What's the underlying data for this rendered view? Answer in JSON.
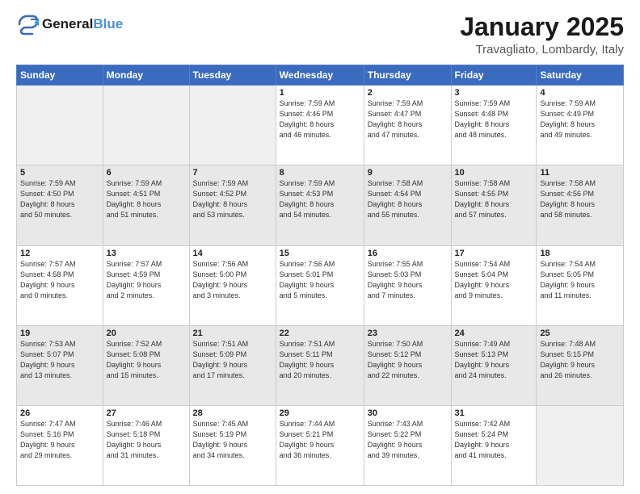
{
  "header": {
    "logo_line1": "General",
    "logo_line2": "Blue",
    "month": "January 2025",
    "location": "Travagliato, Lombardy, Italy"
  },
  "weekdays": [
    "Sunday",
    "Monday",
    "Tuesday",
    "Wednesday",
    "Thursday",
    "Friday",
    "Saturday"
  ],
  "weeks": [
    [
      {
        "day": "",
        "info": ""
      },
      {
        "day": "",
        "info": ""
      },
      {
        "day": "",
        "info": ""
      },
      {
        "day": "1",
        "info": "Sunrise: 7:59 AM\nSunset: 4:46 PM\nDaylight: 8 hours\nand 46 minutes."
      },
      {
        "day": "2",
        "info": "Sunrise: 7:59 AM\nSunset: 4:47 PM\nDaylight: 8 hours\nand 47 minutes."
      },
      {
        "day": "3",
        "info": "Sunrise: 7:59 AM\nSunset: 4:48 PM\nDaylight: 8 hours\nand 48 minutes."
      },
      {
        "day": "4",
        "info": "Sunrise: 7:59 AM\nSunset: 4:49 PM\nDaylight: 8 hours\nand 49 minutes."
      }
    ],
    [
      {
        "day": "5",
        "info": "Sunrise: 7:59 AM\nSunset: 4:50 PM\nDaylight: 8 hours\nand 50 minutes."
      },
      {
        "day": "6",
        "info": "Sunrise: 7:59 AM\nSunset: 4:51 PM\nDaylight: 8 hours\nand 51 minutes."
      },
      {
        "day": "7",
        "info": "Sunrise: 7:59 AM\nSunset: 4:52 PM\nDaylight: 8 hours\nand 53 minutes."
      },
      {
        "day": "8",
        "info": "Sunrise: 7:59 AM\nSunset: 4:53 PM\nDaylight: 8 hours\nand 54 minutes."
      },
      {
        "day": "9",
        "info": "Sunrise: 7:58 AM\nSunset: 4:54 PM\nDaylight: 8 hours\nand 55 minutes."
      },
      {
        "day": "10",
        "info": "Sunrise: 7:58 AM\nSunset: 4:55 PM\nDaylight: 8 hours\nand 57 minutes."
      },
      {
        "day": "11",
        "info": "Sunrise: 7:58 AM\nSunset: 4:56 PM\nDaylight: 8 hours\nand 58 minutes."
      }
    ],
    [
      {
        "day": "12",
        "info": "Sunrise: 7:57 AM\nSunset: 4:58 PM\nDaylight: 9 hours\nand 0 minutes."
      },
      {
        "day": "13",
        "info": "Sunrise: 7:57 AM\nSunset: 4:59 PM\nDaylight: 9 hours\nand 2 minutes."
      },
      {
        "day": "14",
        "info": "Sunrise: 7:56 AM\nSunset: 5:00 PM\nDaylight: 9 hours\nand 3 minutes."
      },
      {
        "day": "15",
        "info": "Sunrise: 7:56 AM\nSunset: 5:01 PM\nDaylight: 9 hours\nand 5 minutes."
      },
      {
        "day": "16",
        "info": "Sunrise: 7:55 AM\nSunset: 5:03 PM\nDaylight: 9 hours\nand 7 minutes."
      },
      {
        "day": "17",
        "info": "Sunrise: 7:54 AM\nSunset: 5:04 PM\nDaylight: 9 hours\nand 9 minutes."
      },
      {
        "day": "18",
        "info": "Sunrise: 7:54 AM\nSunset: 5:05 PM\nDaylight: 9 hours\nand 11 minutes."
      }
    ],
    [
      {
        "day": "19",
        "info": "Sunrise: 7:53 AM\nSunset: 5:07 PM\nDaylight: 9 hours\nand 13 minutes."
      },
      {
        "day": "20",
        "info": "Sunrise: 7:52 AM\nSunset: 5:08 PM\nDaylight: 9 hours\nand 15 minutes."
      },
      {
        "day": "21",
        "info": "Sunrise: 7:51 AM\nSunset: 5:09 PM\nDaylight: 9 hours\nand 17 minutes."
      },
      {
        "day": "22",
        "info": "Sunrise: 7:51 AM\nSunset: 5:11 PM\nDaylight: 9 hours\nand 20 minutes."
      },
      {
        "day": "23",
        "info": "Sunrise: 7:50 AM\nSunset: 5:12 PM\nDaylight: 9 hours\nand 22 minutes."
      },
      {
        "day": "24",
        "info": "Sunrise: 7:49 AM\nSunset: 5:13 PM\nDaylight: 9 hours\nand 24 minutes."
      },
      {
        "day": "25",
        "info": "Sunrise: 7:48 AM\nSunset: 5:15 PM\nDaylight: 9 hours\nand 26 minutes."
      }
    ],
    [
      {
        "day": "26",
        "info": "Sunrise: 7:47 AM\nSunset: 5:16 PM\nDaylight: 9 hours\nand 29 minutes."
      },
      {
        "day": "27",
        "info": "Sunrise: 7:46 AM\nSunset: 5:18 PM\nDaylight: 9 hours\nand 31 minutes."
      },
      {
        "day": "28",
        "info": "Sunrise: 7:45 AM\nSunset: 5:19 PM\nDaylight: 9 hours\nand 34 minutes."
      },
      {
        "day": "29",
        "info": "Sunrise: 7:44 AM\nSunset: 5:21 PM\nDaylight: 9 hours\nand 36 minutes."
      },
      {
        "day": "30",
        "info": "Sunrise: 7:43 AM\nSunset: 5:22 PM\nDaylight: 9 hours\nand 39 minutes."
      },
      {
        "day": "31",
        "info": "Sunrise: 7:42 AM\nSunset: 5:24 PM\nDaylight: 9 hours\nand 41 minutes."
      },
      {
        "day": "",
        "info": ""
      }
    ]
  ]
}
